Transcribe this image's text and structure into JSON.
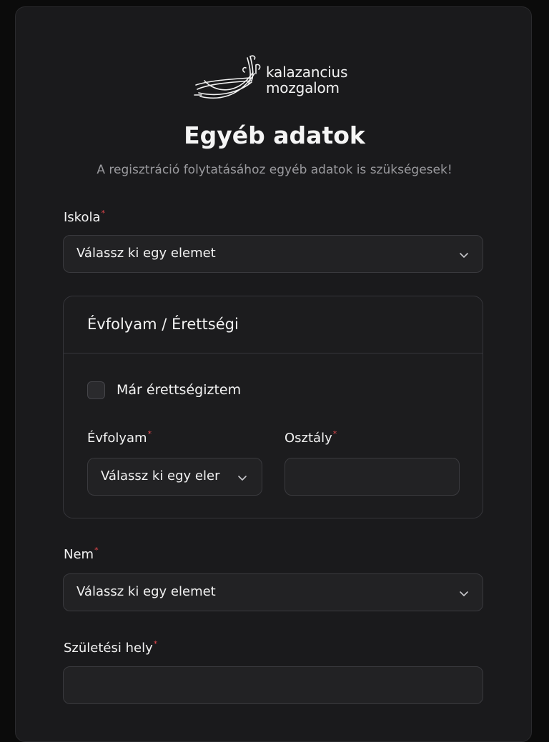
{
  "brand": {
    "line1": "kalazancius",
    "line2": "mozgalom"
  },
  "header": {
    "title": "Egyéb adatok",
    "subtitle": "A regisztráció folytatásához egyéb adatok is szükségesek!"
  },
  "form": {
    "required_mark": "*",
    "iskola": {
      "label": "Iskola",
      "value": "Válassz ki egy elemet"
    },
    "panel": {
      "title": "Évfolyam / Érettségi",
      "checkbox_label": "Már érettségiztem",
      "checkbox_checked": false,
      "evfolyam": {
        "label": "Évfolyam",
        "value": "Válassz ki egy eler"
      },
      "osztaly": {
        "label": "Osztály",
        "value": ""
      }
    },
    "nem": {
      "label": "Nem",
      "value": "Válassz ki egy elemet"
    },
    "szuletesi_hely": {
      "label": "Születési hely",
      "value": ""
    }
  },
  "icons": {
    "dropdown": "chevron-down-icon",
    "logo": "kalazancius-logo"
  },
  "colors": {
    "background": "#0b0b0b",
    "card": "#1a1a1c",
    "required": "#e5484d",
    "muted_text": "#9a9a9e"
  }
}
